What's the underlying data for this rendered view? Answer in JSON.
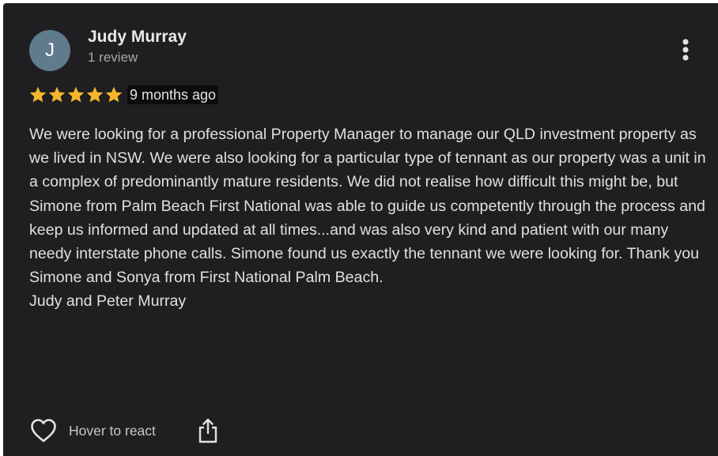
{
  "review": {
    "author": {
      "initial": "J",
      "name": "Judy Murray",
      "meta": "1 review",
      "avatar_color": "#5f7b8c"
    },
    "rating": {
      "stars": 5,
      "max": 5,
      "star_color": "#f5b62b"
    },
    "date": "9 months ago",
    "text": "We were looking for a professional Property Manager to manage our QLD investment property as we lived in NSW. We were also looking for a particular type of tennant as our property was a unit in a complex of predominantly mature residents. We did not realise how difficult this might be, but Simone from Palm Beach First National was able to guide us competently through the process and keep us informed and updated at all times...and was also very kind and patient with our many needy interstate phone calls. Simone found us exactly the tennant we were looking for. Thank you Simone and Sonya from First National Palm Beach.\nJudy and Peter Murray",
    "actions": {
      "react_label": "Hover to react",
      "react_icon": "heart-outline-icon",
      "share_icon": "share-icon",
      "more_icon": "more-vertical-icon"
    }
  },
  "theme": {
    "card_background": "#1f1f21",
    "text_color": "#e0e0e0"
  }
}
